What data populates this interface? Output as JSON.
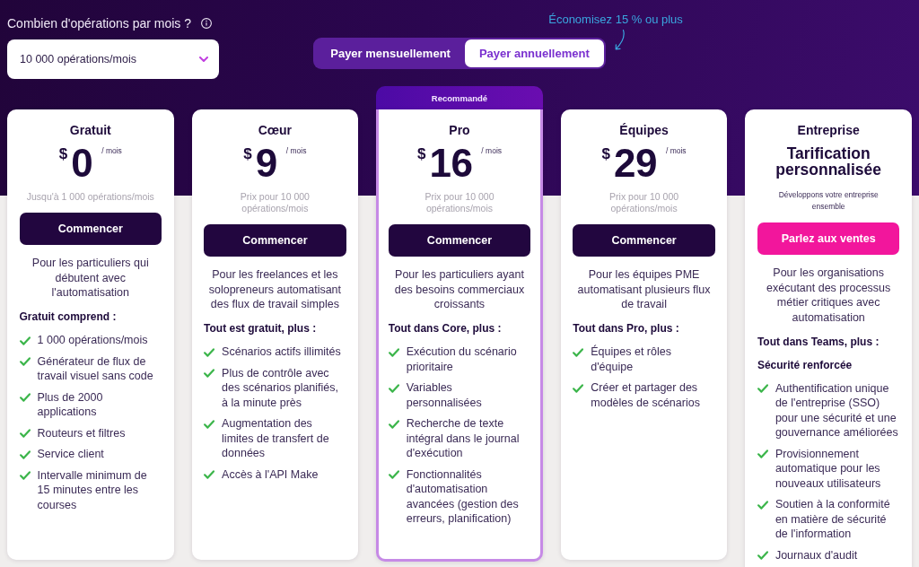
{
  "operations": {
    "label": "Combien d'opérations par mois ?",
    "value": "10 000 opérations/mois"
  },
  "billing": {
    "options": [
      {
        "label": "Payer mensuellement",
        "selected": false
      },
      {
        "label": "Payer annuellement",
        "selected": true
      }
    ],
    "savings_note": "Économisez 15 % ou plus"
  },
  "plans": [
    {
      "name": "Gratuit",
      "kind": "standard",
      "recommended": false,
      "currency": "$",
      "amount": "0",
      "period": "/ mois",
      "note": "Jusqu'à 1 000 opérations/mois",
      "cta": {
        "label": "Commencer",
        "kind": "dark"
      },
      "description": "Pour les particuliers qui débutent avec l'automatisation",
      "features_title": "Gratuit comprend :",
      "features": [
        "1 000 opérations/mois",
        "Générateur de flux de travail visuel sans code",
        "Plus de 2000 applications",
        "Routeurs et filtres",
        "Service client",
        "Intervalle minimum de 15 minutes entre les courses"
      ]
    },
    {
      "name": "Cœur",
      "kind": "standard",
      "recommended": false,
      "currency": "$",
      "amount": "9",
      "period": "/ mois",
      "note": "Prix pour 10 000 opérations/mois",
      "cta": {
        "label": "Commencer",
        "kind": "dark"
      },
      "description": "Pour les freelances et les solopreneurs automatisant des flux de travail simples",
      "features_title": "Tout est gratuit, plus :",
      "features": [
        "Scénarios actifs illimités",
        "Plus de contrôle avec des scénarios planifiés, à la minute près",
        "Augmentation des limites de transfert de données",
        "Accès à l'API Make"
      ]
    },
    {
      "name": "Pro",
      "kind": "standard",
      "recommended": true,
      "badge": "Recommandé",
      "currency": "$",
      "amount": "16",
      "period": "/ mois",
      "note": "Prix pour 10 000 opérations/mois",
      "cta": {
        "label": "Commencer",
        "kind": "dark"
      },
      "description": "Pour les particuliers ayant des besoins commerciaux croissants",
      "features_title": "Tout dans Core, plus :",
      "features": [
        "Exécution du scénario prioritaire",
        "Variables personnalisées",
        "Recherche de texte intégral dans le journal d'exécution",
        "Fonctionnalités d'automatisation avancées (gestion des erreurs, planification)"
      ]
    },
    {
      "name": "Équipes",
      "kind": "standard",
      "recommended": false,
      "currency": "$",
      "amount": "29",
      "period": "/ mois",
      "note": "Prix pour 10 000 opérations/mois",
      "cta": {
        "label": "Commencer",
        "kind": "dark"
      },
      "description": "Pour les équipes PME automatisant plusieurs flux de travail",
      "features_title": "Tout dans Pro, plus :",
      "features": [
        "Équipes et rôles d'équipe",
        "Créer et partager des modèles de scénarios"
      ]
    },
    {
      "name": "Entreprise",
      "kind": "custom",
      "recommended": false,
      "price_text": "Tarification personnalisée",
      "note": "Développons votre entreprise ensemble",
      "cta": {
        "label": "Parlez aux ventes",
        "kind": "accent"
      },
      "description": "Pour les organisations exécutant des processus métier critiques avec automatisation",
      "features_title": "Tout dans Teams, plus :",
      "features_subtitle": "Sécurité renforcée",
      "features": [
        "Authentification unique de l'entreprise (SSO) pour une sécurité et une gouvernance améliorées",
        "Provisionnement automatique pour les nouveaux utilisateurs",
        "Soutien à la conformité en matière de sécurité de l'information",
        "Journaux d'audit"
      ]
    }
  ]
}
